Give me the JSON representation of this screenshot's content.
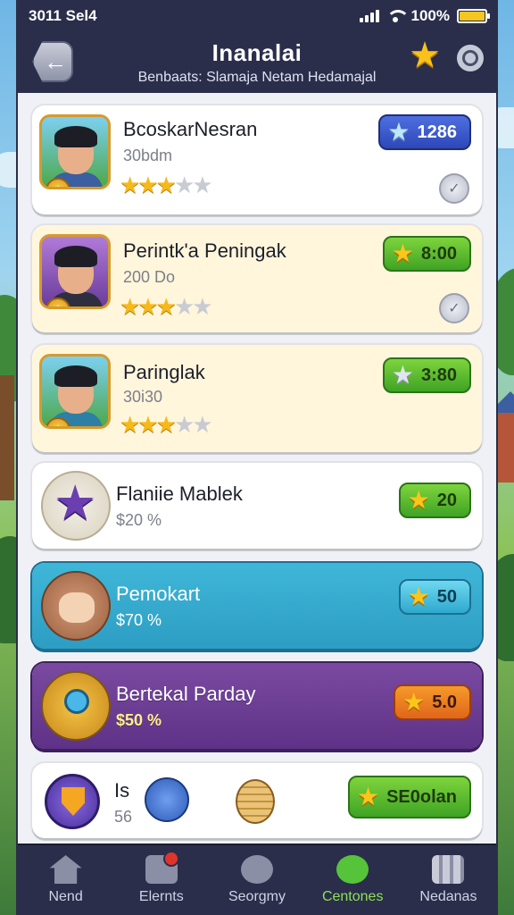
{
  "status": {
    "time": "3011 Sel4",
    "battery": "100%"
  },
  "header": {
    "title": "Inanalai",
    "subtitle": "Benbaats: Slamaja Netam Hedamajal"
  },
  "items": [
    {
      "name": "BcoskarNesran",
      "sub": "30bdm",
      "stars_on": 3,
      "stars_off": 2,
      "badge": "1286"
    },
    {
      "name": "Perintk'a Peningak",
      "sub": "200 Do",
      "stars_on": 3,
      "stars_off": 2,
      "badge": "8:00"
    },
    {
      "name": "Paringlak",
      "sub": "30i30",
      "stars_on": 3,
      "stars_off": 2,
      "badge": "3:80"
    },
    {
      "name": "Flaniie Mablek",
      "sub": "$20 %",
      "badge": "20"
    },
    {
      "name": "Pemokart",
      "sub": "$70 %",
      "badge": "50"
    },
    {
      "name": "Bertekal Parday",
      "sub": "$50 %",
      "badge": "5.0"
    },
    {
      "name": "Is",
      "sub": "56",
      "badge": "SE0olan"
    }
  ],
  "nav": [
    {
      "label": "Nend",
      "icon": "home-icon"
    },
    {
      "label": "Elernts",
      "icon": "chest-icon"
    },
    {
      "label": "Seorgmy",
      "icon": "sword-icon"
    },
    {
      "label": "Centones",
      "icon": "gem-icon"
    },
    {
      "label": "Nedanas",
      "icon": "grid-icon"
    }
  ]
}
